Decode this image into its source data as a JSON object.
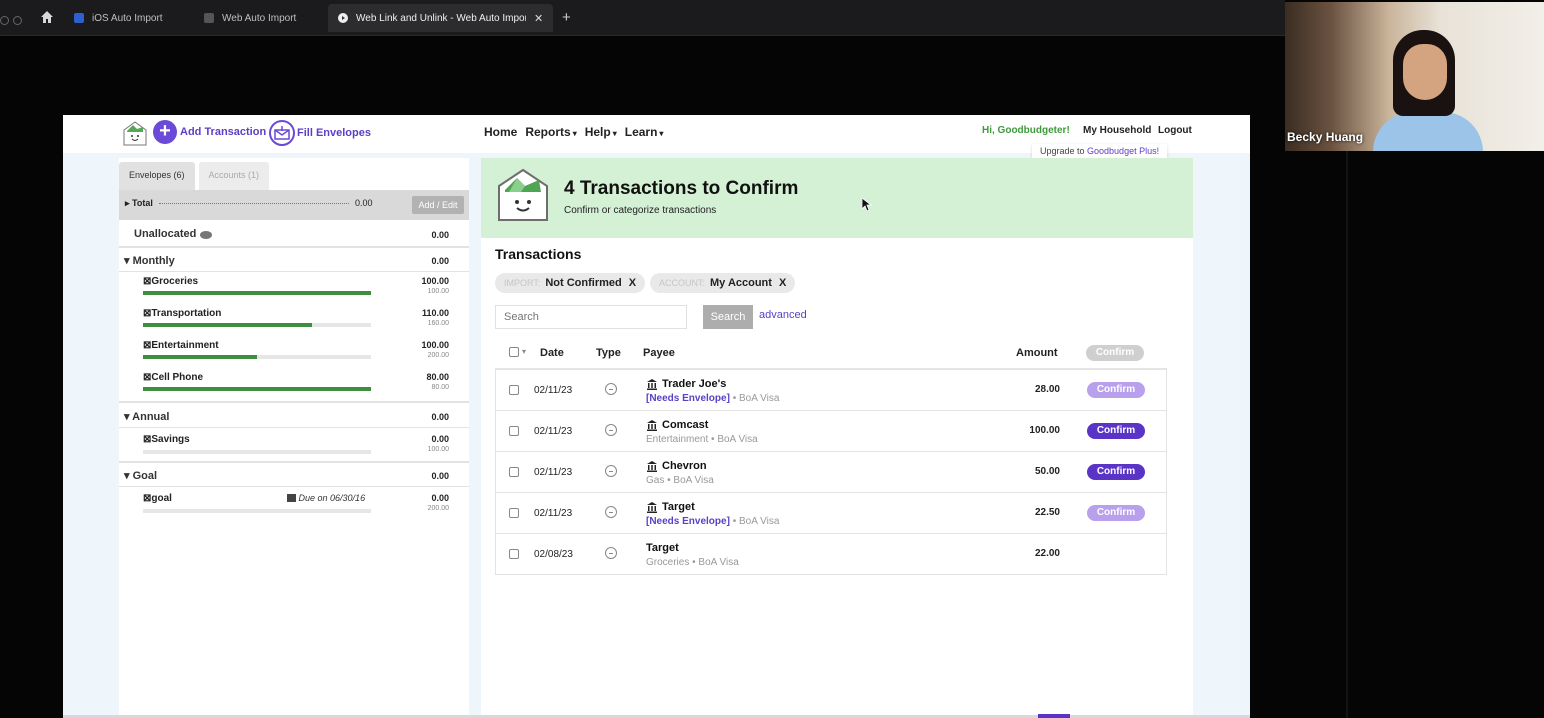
{
  "browser": {
    "tabs": [
      {
        "label": "iOS Auto Import"
      },
      {
        "label": "Web Auto Import"
      },
      {
        "label": "Web Link and Unlink - Web Auto Import"
      }
    ],
    "new_tab_label": "+",
    "close_label": "✕"
  },
  "video": {
    "participant_name": "Becky Huang"
  },
  "header": {
    "add_transaction": "Add Transaction",
    "fill_envelopes": "Fill Envelopes",
    "nav": [
      {
        "label": "Home"
      },
      {
        "label": "Reports"
      },
      {
        "label": "Help"
      },
      {
        "label": "Learn"
      }
    ],
    "caret": "▾",
    "greeting": "Hi, Goodbudgeter!",
    "household": "My Household",
    "logout": "Logout",
    "upgrade_prefix": "Upgrade to ",
    "upgrade_link": "Goodbudget Plus!"
  },
  "left": {
    "tabs": [
      {
        "label": "Envelopes (6)"
      },
      {
        "label": "Accounts (1)"
      }
    ],
    "total_label": "▸ Total",
    "total_value": "0.00",
    "add_edit": "Add / Edit",
    "unallocated": {
      "label": "Unallocated",
      "value": "0.00"
    },
    "groups": [
      {
        "label": "▾ Monthly",
        "value": "0.00"
      },
      {
        "label": "▾ Annual",
        "value": "0.00"
      },
      {
        "label": "▾ Goal",
        "value": "0.00"
      }
    ],
    "envelopes": [
      {
        "name": "⊠Groceries",
        "value": "100.00",
        "budget": "100.00",
        "fill": 1.0
      },
      {
        "name": "⊠Transportation",
        "value": "110.00",
        "budget": "160.00",
        "fill": 0.74
      },
      {
        "name": "⊠Entertainment",
        "value": "100.00",
        "budget": "200.00",
        "fill": 0.5
      },
      {
        "name": "⊠Cell Phone",
        "value": "80.00",
        "budget": "80.00",
        "fill": 1.0
      },
      {
        "name": "⊠Savings",
        "value": "0.00",
        "budget": "100.00",
        "fill": 0.0
      },
      {
        "name": "⊠goal",
        "value": "0.00",
        "budget": "200.00",
        "fill": 0.0,
        "due": "Due on 06/30/16"
      }
    ]
  },
  "banner": {
    "title": "4 Transactions to Confirm",
    "subtitle": "Confirm or categorize transactions"
  },
  "transactions": {
    "heading": "Transactions",
    "filters": [
      {
        "key": "IMPORT:",
        "value": "Not Confirmed",
        "remove": "X"
      },
      {
        "key": "ACCOUNT:",
        "value": "My Account",
        "remove": "X"
      }
    ],
    "search_placeholder": "Search",
    "search_button": "Search",
    "advanced": "advanced",
    "columns": {
      "date": "Date",
      "type": "Type",
      "payee": "Payee",
      "amount": "Amount",
      "confirm": "Confirm"
    },
    "rows": [
      {
        "date": "02/11/23",
        "payee": "Trader Joe's",
        "need": "[Needs Envelope]",
        "detail": " • BoA Visa",
        "amount": "28.00",
        "confirm": "Confirm",
        "style": "light",
        "bank": true
      },
      {
        "date": "02/11/23",
        "payee": "Comcast",
        "need": "",
        "detail": "Entertainment • BoA Visa",
        "amount": "100.00",
        "confirm": "Confirm",
        "style": "dark",
        "bank": true
      },
      {
        "date": "02/11/23",
        "payee": "Chevron",
        "need": "",
        "detail": "Gas • BoA Visa",
        "amount": "50.00",
        "confirm": "Confirm",
        "style": "dark",
        "bank": true
      },
      {
        "date": "02/11/23",
        "payee": "Target",
        "need": "[Needs Envelope]",
        "detail": " • BoA Visa",
        "amount": "22.50",
        "confirm": "Confirm",
        "style": "light",
        "bank": true
      },
      {
        "date": "02/08/23",
        "payee": "Target",
        "need": "",
        "detail": "Groceries • BoA Visa",
        "amount": "22.00",
        "confirm": "",
        "style": "none",
        "bank": false
      }
    ]
  },
  "colors": {
    "accent": "#5a34c6",
    "green": "#3e8e3f",
    "banner": "#d4f0d5"
  }
}
